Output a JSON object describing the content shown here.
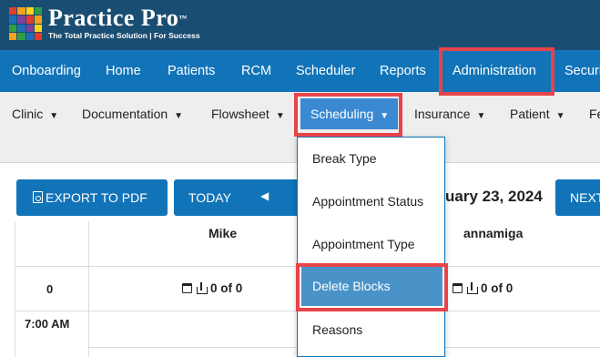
{
  "brand": {
    "name": "Practice Pro",
    "trademark": "™",
    "tagline": "The Total Practice Solution | For Success",
    "logo_colors": [
      "#e23c2f",
      "#f5a21b",
      "#f9d71c",
      "#2f9e45",
      "#1f6fb8",
      "#7f3fa0",
      "#e23c2f",
      "#f5a21b",
      "#2f9e45",
      "#1f6fb8",
      "#7f3fa0",
      "#f9d71c",
      "#f5a21b",
      "#2f9e45",
      "#1f6fb8",
      "#e23c2f"
    ]
  },
  "nav": {
    "items": [
      "Onboarding",
      "Home",
      "Patients",
      "RCM",
      "Scheduler",
      "Reports",
      "Administration",
      "Securi"
    ],
    "highlighted": "Administration"
  },
  "subnav": {
    "items": [
      "Clinic",
      "Documentation",
      "Flowsheet",
      "Scheduling",
      "Insurance",
      "Patient",
      "Fe"
    ],
    "active": "Scheduling",
    "caret_icon": "caret-down-icon"
  },
  "dropdown": {
    "items": [
      "Break Type",
      "Appointment Status",
      "Appointment Type",
      "Delete Blocks",
      "Reasons"
    ],
    "selected": "Delete Blocks"
  },
  "calendar": {
    "export_label": "EXPORT TO PDF",
    "today_label": "TODAY",
    "prev_icon": "◀",
    "next_label": "NEXT",
    "date_text": "uary 23, 2024",
    "providers": [
      "Mike",
      "annamiga"
    ],
    "row_zero_label": "0",
    "time_label": "7:00 AM",
    "counters": [
      {
        "count": "0",
        "of": "of",
        "total": "0"
      },
      {
        "count": "0",
        "of": "of",
        "total": "0"
      }
    ]
  },
  "colors": {
    "header": "#1a4d72",
    "nav": "#1274b8",
    "subnav": "#eeeeee",
    "active_tab": "#3b8ad1",
    "selected_item": "#4a93c8",
    "highlight": "#e8434a"
  }
}
